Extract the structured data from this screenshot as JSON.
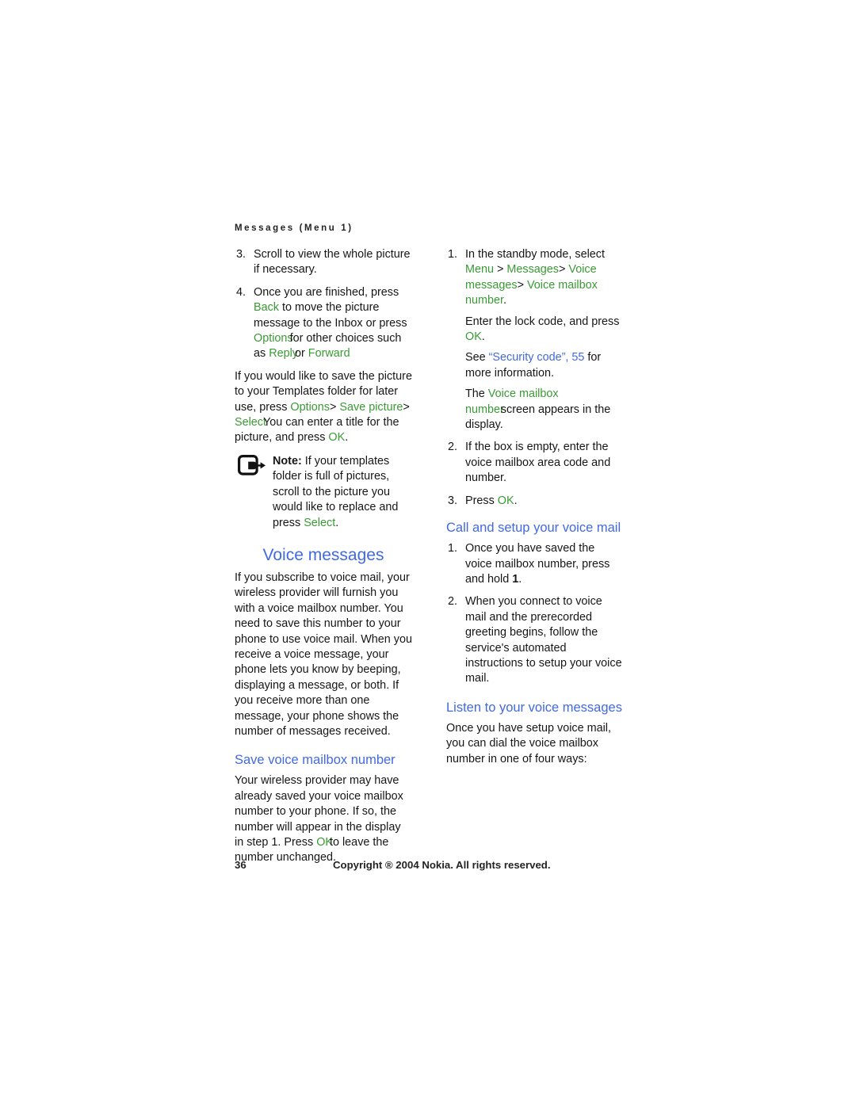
{
  "header": {
    "running_head": "Messages (Menu 1)"
  },
  "left_column": {
    "list_items": [
      {
        "num": "3.",
        "parts": [
          {
            "text": "Scroll to view the whole picture if necessary.",
            "style": "plain"
          }
        ]
      },
      {
        "num": "4.",
        "parts": [
          {
            "text": "Once you are finished, press ",
            "style": "plain"
          },
          {
            "text": "Back",
            "style": "ui"
          },
          {
            "text": " to move the picture message to the Inbox or press ",
            "style": "plain"
          },
          {
            "text": "Options",
            "style": "ui"
          },
          {
            "text": "for other choices such as ",
            "style": "plain"
          },
          {
            "text": "Reply",
            "style": "ui"
          },
          {
            "text": "or ",
            "style": "plain"
          },
          {
            "text": "Forward",
            "style": "ui"
          }
        ]
      }
    ],
    "para_save_picture": [
      {
        "text": "If you would like to save the picture to your Templates folder for later use, press ",
        "style": "plain"
      },
      {
        "text": "Options",
        "style": "ui"
      },
      {
        "text": "> ",
        "style": "plain"
      },
      {
        "text": "Save picture",
        "style": "ui"
      },
      {
        "text": "> ",
        "style": "plain"
      },
      {
        "text": "Select",
        "style": "ui"
      },
      {
        "text": "You can enter a title for the picture, and press ",
        "style": "plain"
      },
      {
        "text": "OK",
        "style": "ui"
      },
      {
        "text": ".",
        "style": "plain"
      }
    ],
    "note": {
      "icon": "note-hand-pointer-icon",
      "label": "Note:",
      "parts": [
        {
          "text": " If your templates folder is full of pictures, scroll to the picture you would like to replace and press ",
          "style": "plain"
        },
        {
          "text": "Select",
          "style": "ui"
        },
        {
          "text": ".",
          "style": "plain"
        }
      ]
    },
    "heading_voice_messages": "Voice messages",
    "para_voice_messages": "If you subscribe to voice mail, your wireless provider will furnish you with a voice mailbox number. You need to save this number to your phone to use voice mail. When you receive a voice message, your phone lets you know by beeping, displaying a message, or both. If you receive more than one message, your phone shows the number of messages received.",
    "heading_save_voice_mailbox": "Save voice mailbox number",
    "para_save_voice_mailbox": [
      {
        "text": "Your wireless provider may have already saved your voice mailbox number to your phone. If so, the number will appear in the display in step 1. Press ",
        "style": "plain"
      },
      {
        "text": "OK",
        "style": "ui"
      },
      {
        "text": "to leave the number unchanged.",
        "style": "plain"
      }
    ]
  },
  "right_column": {
    "list_items": [
      {
        "num": "1.",
        "parts": [
          {
            "text": "In the standby mode, select ",
            "style": "plain"
          },
          {
            "text": "Menu",
            "style": "ui"
          },
          {
            "text": " > ",
            "style": "plain"
          },
          {
            "text": "Messages",
            "style": "ui"
          },
          {
            "text": "> ",
            "style": "plain"
          },
          {
            "text": "Voice messages",
            "style": "ui"
          },
          {
            "text": "> ",
            "style": "plain"
          },
          {
            "text": "Voice mailbox number",
            "style": "ui"
          },
          {
            "text": ".",
            "style": "plain"
          }
        ],
        "sub_paras": [
          [
            {
              "text": "Enter the lock code, and press ",
              "style": "plain"
            },
            {
              "text": "OK",
              "style": "ui"
            },
            {
              "text": ".",
              "style": "plain"
            }
          ],
          [
            {
              "text": "See ",
              "style": "plain"
            },
            {
              "text": "“Security code”, 55",
              "style": "link"
            },
            {
              "text": " for more information.",
              "style": "plain"
            }
          ],
          [
            {
              "text": "The ",
              "style": "plain"
            },
            {
              "text": "Voice mailbox number",
              "style": "ui"
            },
            {
              "text": "screen appears in the display.",
              "style": "plain"
            }
          ]
        ]
      },
      {
        "num": "2.",
        "parts": [
          {
            "text": "If the box is empty, enter the voice mailbox area code and number.",
            "style": "plain"
          }
        ]
      },
      {
        "num": "3.",
        "parts": [
          {
            "text": "Press ",
            "style": "plain"
          },
          {
            "text": "OK",
            "style": "ui"
          },
          {
            "text": ".",
            "style": "plain"
          }
        ]
      }
    ],
    "heading_call_setup": "Call and setup your voice mail",
    "list_items_call_setup": [
      {
        "num": "1.",
        "parts": [
          {
            "text": "Once you have saved the voice mailbox number, press and hold ",
            "style": "plain"
          },
          {
            "text": "1",
            "style": "bold"
          },
          {
            "text": ".",
            "style": "plain"
          }
        ]
      },
      {
        "num": "2.",
        "parts": [
          {
            "text": "When you connect to voice mail and the prerecorded greeting begins, follow the service's automated instructions to setup your voice mail.",
            "style": "plain"
          }
        ]
      }
    ],
    "heading_listen": "Listen to your voice messages",
    "para_listen": "Once you have setup voice mail, you can dial the voice mailbox number in one of four ways:"
  },
  "footer": {
    "page_number": "36",
    "copyright": "Copyright ® 2004 Nokia. All rights reserved."
  },
  "colors": {
    "ui_term_green": "#3A9A34",
    "heading_blue": "#4169E1",
    "link_blue": "#4169E1",
    "body_text": "#161616"
  }
}
